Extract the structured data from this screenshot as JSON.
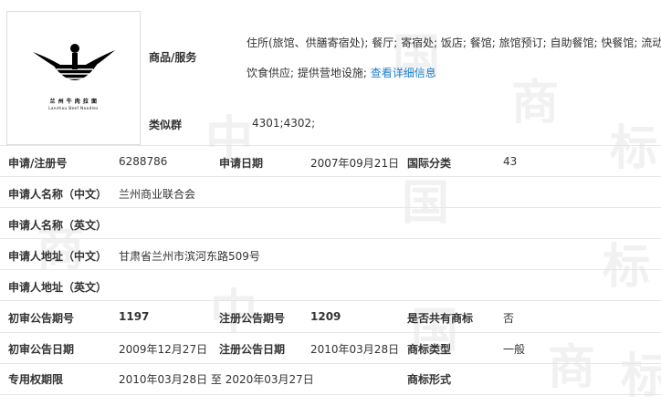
{
  "top": {
    "goods_label": "商品/服务",
    "goods_line1": "住所(旅馆、供膳寄宿处); 餐厅; 寄宿处; 饭店; 餐馆; 旅馆预订; 自助餐馆; 快餐馆; 流动",
    "goods_line2": "饮食供应; 提供营地设施;",
    "detail_link": "查看详细信息",
    "similar_label": "类似群",
    "similar_value": "4301;4302;"
  },
  "logo": {
    "caption1": "兰 州 牛 肉 拉 面",
    "caption2": "Lanzhou Beef Noodles"
  },
  "rows": {
    "reg_no_label": "申请/注册号",
    "reg_no": "6288786",
    "apply_date_label": "申请日期",
    "apply_date": "2007年09月21日",
    "intl_class_label": "国际分类",
    "intl_class": "43",
    "applicant_cn_label": "申请人名称（中文）",
    "applicant_cn": "兰州商业联合会",
    "applicant_en_label": "申请人名称（英文）",
    "applicant_en": "",
    "address_cn_label": "申请人地址（中文）",
    "address_cn": "甘肃省兰州市滨河东路509号",
    "address_en_label": "申请人地址（英文）",
    "address_en": "",
    "prelim_no_label": "初审公告期号",
    "prelim_no": "1197",
    "reg_pub_no_label": "注册公告期号",
    "reg_pub_no": "1209",
    "shared_label": "是否共有商标",
    "shared": "否",
    "prelim_date_label": "初审公告日期",
    "prelim_date": "2009年12月27日",
    "reg_date_label": "注册公告日期",
    "reg_date": "2010年03月28日",
    "tm_type_label": "商标类型",
    "tm_type": "一般",
    "term_label": "专用权期限",
    "term": "2010年03月28日 至 2020年03月27日",
    "tm_form_label": "商标形式",
    "tm_form": ""
  },
  "watermark": [
    "中",
    "国",
    "商",
    "标",
    "中",
    "国",
    "商",
    "标",
    "中",
    "国",
    "商",
    "标"
  ]
}
